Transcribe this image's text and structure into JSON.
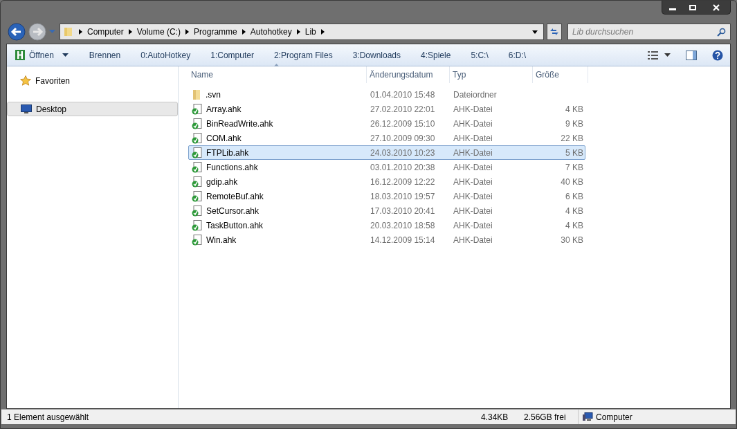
{
  "breadcrumb": [
    "Computer",
    "Volume (C:)",
    "Programme",
    "Autohotkey",
    "Lib"
  ],
  "search": {
    "placeholder": "Lib durchsuchen"
  },
  "toolbar": [
    {
      "kind": "menu",
      "label": "Öffnen"
    },
    {
      "kind": "plain",
      "label": "Brennen"
    },
    {
      "kind": "plain",
      "label": "0:AutoHotkey"
    },
    {
      "kind": "plain",
      "label": "1:Computer"
    },
    {
      "kind": "plain",
      "label": "2:Program Files"
    },
    {
      "kind": "plain",
      "label": "3:Downloads"
    },
    {
      "kind": "plain",
      "label": "4:Spiele"
    },
    {
      "kind": "plain",
      "label": "5:C:\\"
    },
    {
      "kind": "plain",
      "label": "6:D:\\"
    }
  ],
  "sidebar": {
    "items": [
      {
        "kind": "favorites",
        "label": "Favoriten",
        "selected": false
      },
      {
        "kind": "desktop",
        "label": "Desktop",
        "selected": true
      }
    ]
  },
  "table": {
    "columns": [
      "Name",
      "Änderungsdatum",
      "Typ",
      "Größe"
    ],
    "rows": [
      {
        "kind": "folder",
        "name": ".svn",
        "date": "01.04.2010 15:48",
        "type": "Dateiordner",
        "selected": false
      },
      {
        "kind": "file",
        "name": "Array.ahk",
        "date": "27.02.2010 22:01",
        "type": "AHK-Datei",
        "size": "4 KB",
        "selected": false
      },
      {
        "kind": "file",
        "name": "BinReadWrite.ahk",
        "date": "26.12.2009 15:10",
        "type": "AHK-Datei",
        "size": "9 KB",
        "selected": false
      },
      {
        "kind": "file",
        "name": "COM.ahk",
        "date": "27.10.2009 09:30",
        "type": "AHK-Datei",
        "size": "22 KB",
        "selected": false
      },
      {
        "kind": "file",
        "name": "FTPLib.ahk",
        "date": "24.03.2010 10:23",
        "type": "AHK-Datei",
        "size": "5 KB",
        "selected": true
      },
      {
        "kind": "file",
        "name": "Functions.ahk",
        "date": "03.01.2010 20:38",
        "type": "AHK-Datei",
        "size": "7 KB",
        "selected": false
      },
      {
        "kind": "file",
        "name": "gdip.ahk",
        "date": "16.12.2009 12:22",
        "type": "AHK-Datei",
        "size": "40 KB",
        "selected": false
      },
      {
        "kind": "file",
        "name": "RemoteBuf.ahk",
        "date": "18.03.2010 19:57",
        "type": "AHK-Datei",
        "size": "6 KB",
        "selected": false
      },
      {
        "kind": "file",
        "name": "SetCursor.ahk",
        "date": "17.03.2010 20:41",
        "type": "AHK-Datei",
        "size": "4 KB",
        "selected": false
      },
      {
        "kind": "file",
        "name": "TaskButton.ahk",
        "date": "20.03.2010 18:58",
        "type": "AHK-Datei",
        "size": "4 KB",
        "selected": false
      },
      {
        "kind": "file",
        "name": "Win.ahk",
        "date": "14.12.2009 15:14",
        "type": "AHK-Datei",
        "size": "30 KB",
        "selected": false
      }
    ]
  },
  "status_bar": {
    "selection": "1 Element ausgewählt",
    "size": "4.34KB",
    "free": "2.56GB frei",
    "location": "Computer"
  }
}
